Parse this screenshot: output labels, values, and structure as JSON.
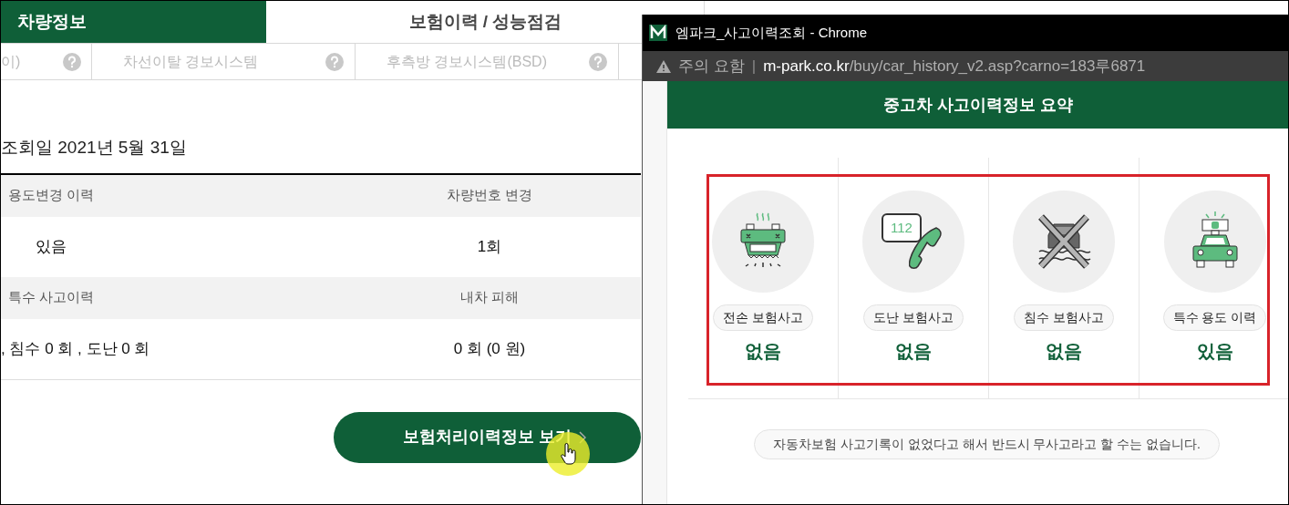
{
  "tabs": [
    {
      "label": "차량정보",
      "selected": true
    },
    {
      "label": "보험이력 / 성능점검",
      "selected": false
    }
  ],
  "features": [
    {
      "label": "이)"
    },
    {
      "label": "차선이탈 경보시스템"
    },
    {
      "label": "후측방 경보시스템(BSD)"
    }
  ],
  "lookup_date": "조회일 2021년 5월 31일",
  "history_table": {
    "rows": [
      {
        "kind": "header",
        "cells": [
          "용도변경 이력",
          "차량번호 변경"
        ]
      },
      {
        "kind": "value",
        "cells": [
          "있음",
          "1회"
        ]
      },
      {
        "kind": "header",
        "cells": [
          "특수 사고이력",
          "내차 피해"
        ]
      },
      {
        "kind": "value",
        "cells": [
          ", 침수 0 회 , 도난 0 회",
          "0 회 (0 원)"
        ]
      }
    ]
  },
  "button": {
    "label": "보험처리이력정보 보기"
  },
  "popup": {
    "title": "엠파크_사고이력조회 - Chrome",
    "security": "주의 요함",
    "separator": "|",
    "url_host": "m-park.co.kr",
    "url_path": "/buy/car_history_v2.asp?carno=183루6871",
    "heading": "중고차 사고이력정보 요약",
    "highlighted": true,
    "items": [
      {
        "kind": "total_loss",
        "label": "전손 보험사고",
        "value": "없음"
      },
      {
        "kind": "theft",
        "label": "도난 보험사고",
        "value": "없음",
        "badge": "112"
      },
      {
        "kind": "flood",
        "label": "침수 보험사고",
        "value": "없음"
      },
      {
        "kind": "special_use",
        "label": "특수 용도 이력",
        "value": "있음"
      }
    ],
    "note": "자동차보험 사고기록이 없었다고 해서 반드시 무사고라고 할 수는 없습니다."
  }
}
